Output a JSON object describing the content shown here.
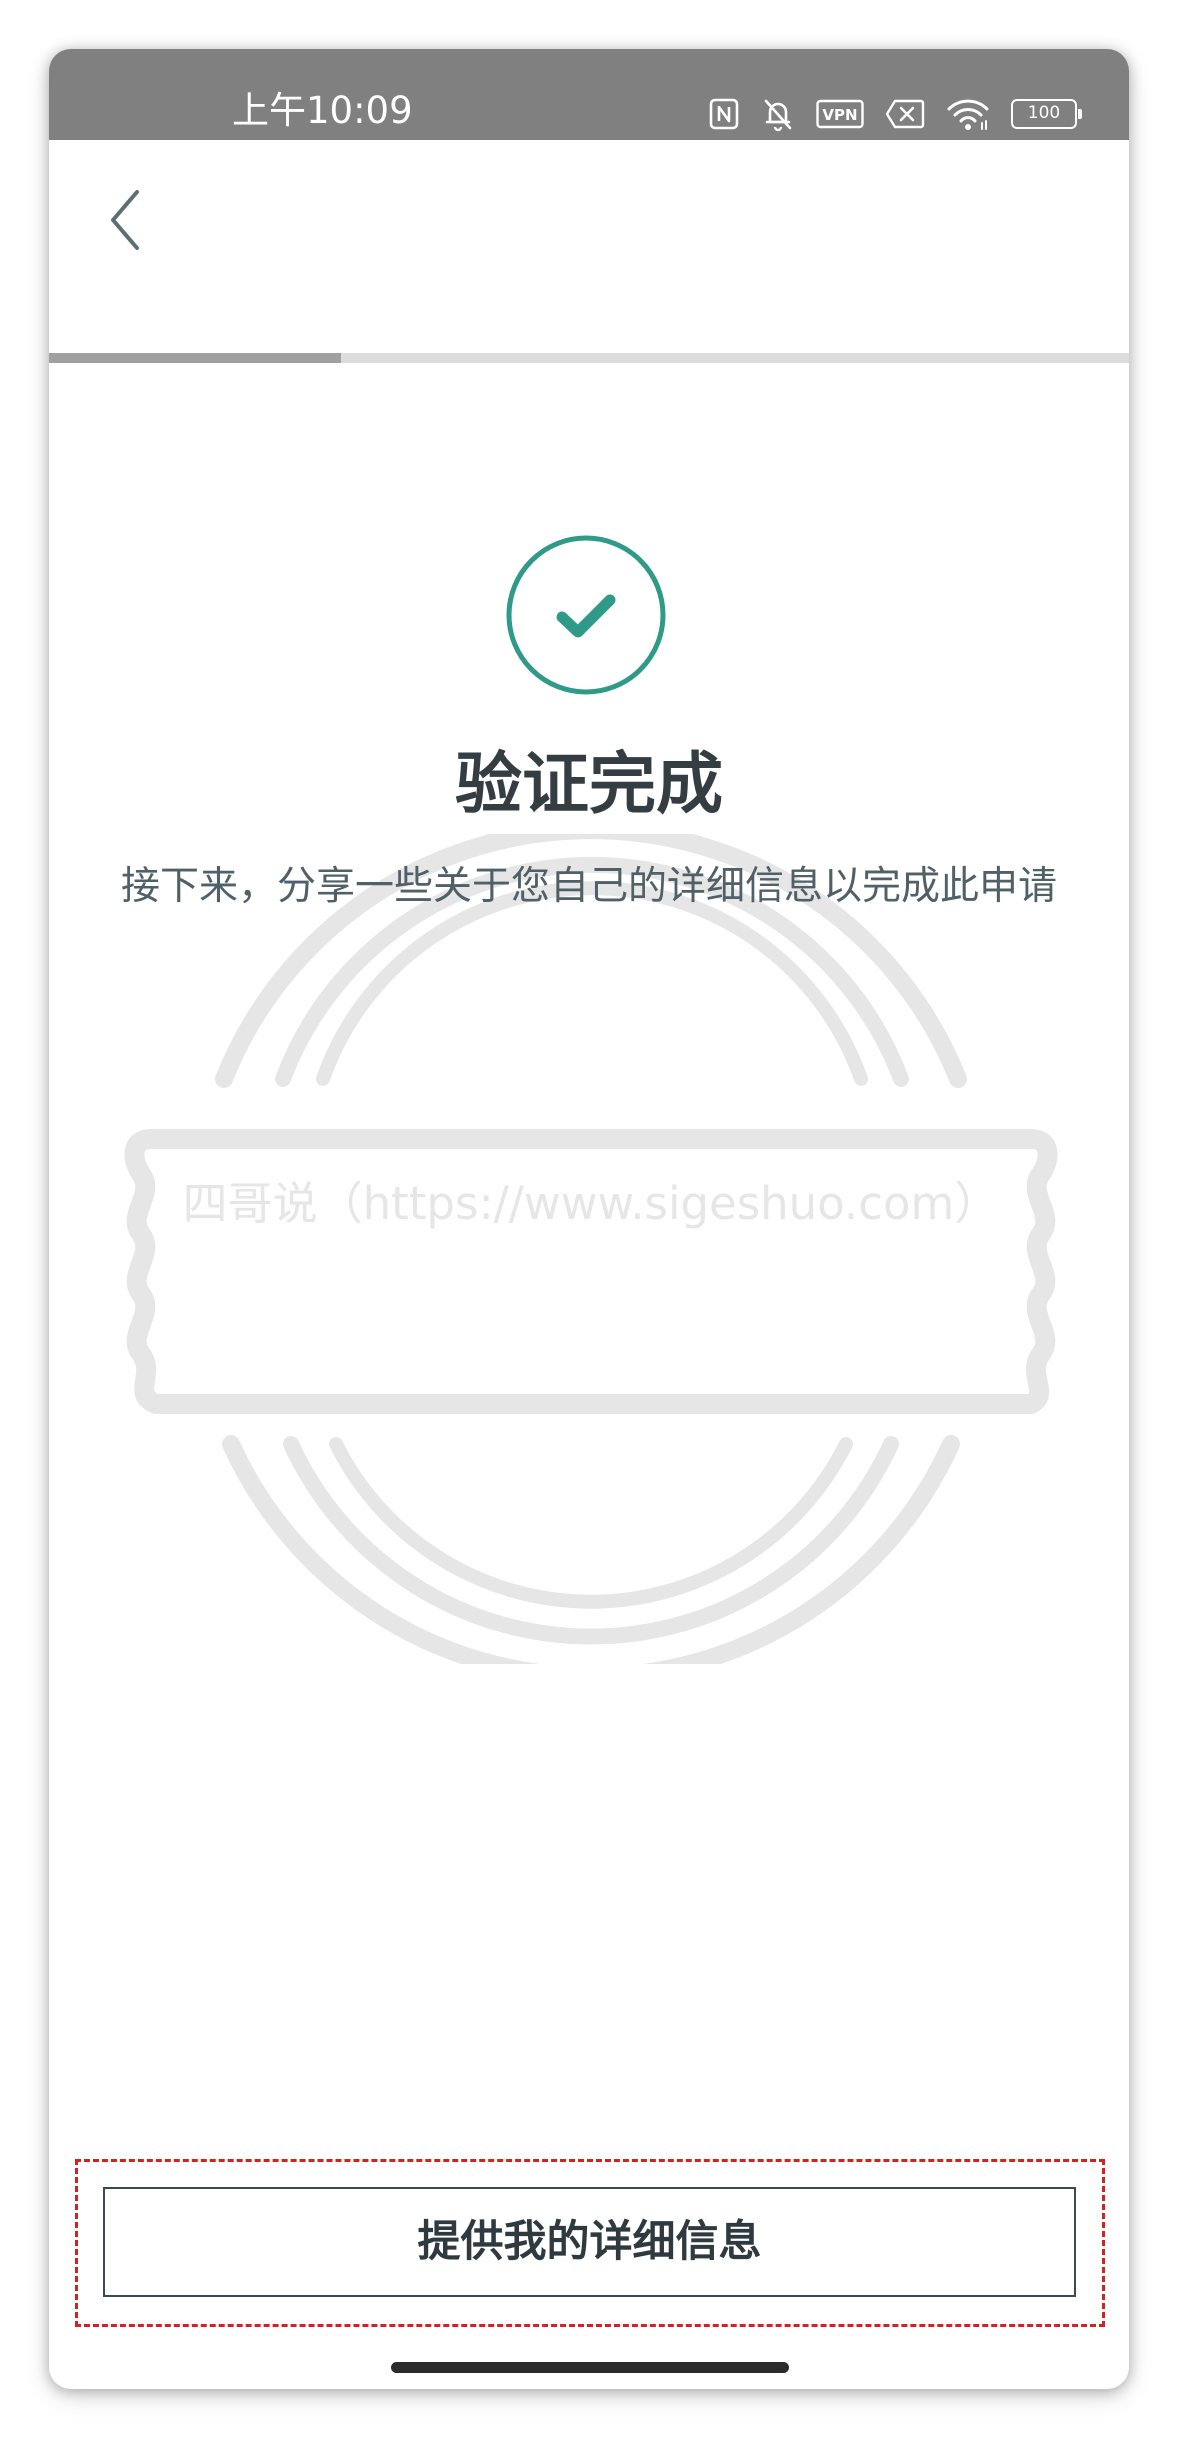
{
  "status_bar": {
    "time": "上午10:09",
    "icons": [
      "nfc-icon",
      "bell-off-icon",
      "vpn-icon",
      "sim-x-icon",
      "wifi-icon",
      "battery-icon"
    ],
    "vpn_label": "VPN",
    "battery_level": "100",
    "color": "#808080"
  },
  "header": {
    "back_icon": "chevron-left-icon"
  },
  "progress": {
    "fraction": 0.27
  },
  "main": {
    "status_icon": "check-circle-icon",
    "title": "验证完成",
    "subtitle": "接下来，分享一些关于您自己的详细信息以完成此申请"
  },
  "watermark": {
    "text": "四哥说（https://www.sigeshuo.com）"
  },
  "footer": {
    "button_label": "提供我的详细信息"
  },
  "colors": {
    "accent": "#2e9a87",
    "title": "#333d42",
    "subtitle": "#506068",
    "highlight": "#d42121"
  }
}
